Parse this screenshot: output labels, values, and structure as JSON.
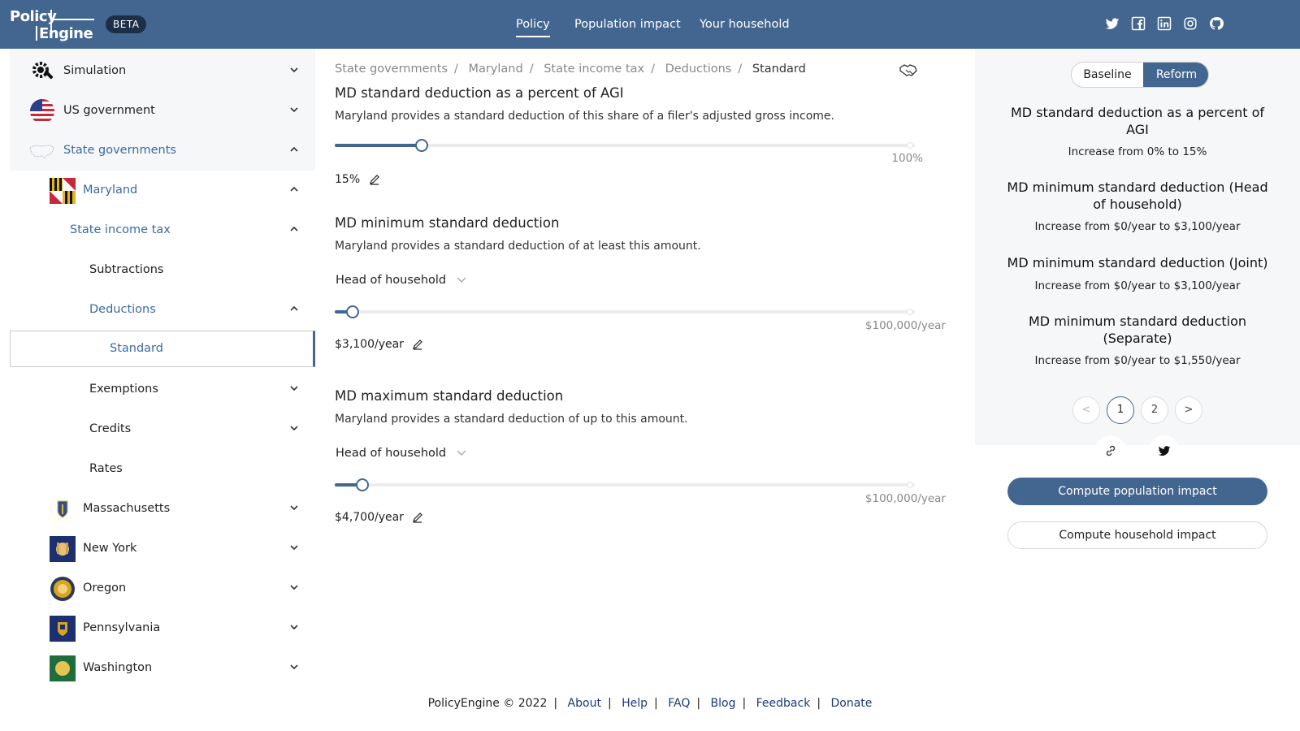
{
  "header": {
    "logo_line1": "Policy",
    "logo_line2": "Engine",
    "beta": "BETA",
    "nav": [
      {
        "label": "Policy",
        "active": true
      },
      {
        "label": "Population impact",
        "active": false
      },
      {
        "label": "Your household",
        "active": false
      }
    ],
    "social_icons": [
      "twitter-icon",
      "facebook-icon",
      "linkedin-icon",
      "instagram-icon",
      "github-icon"
    ],
    "background_color": "#436690"
  },
  "sidebar": {
    "items": [
      {
        "label": "Simulation",
        "icon": "gear-icon",
        "expanded": false
      },
      {
        "label": "US government",
        "icon": "us-flag-icon",
        "expanded": false
      },
      {
        "label": "State governments",
        "icon": "us-map-icon",
        "expanded": true
      },
      {
        "label": "Maryland",
        "icon": "maryland-flag-icon",
        "expanded": true
      },
      {
        "label": "State income tax",
        "expanded": true
      },
      {
        "label": "Subtractions"
      },
      {
        "label": "Deductions",
        "expanded": true
      },
      {
        "label": "Standard",
        "selected": true
      },
      {
        "label": "Exemptions",
        "expanded": false
      },
      {
        "label": "Credits",
        "expanded": false
      },
      {
        "label": "Rates"
      },
      {
        "label": "Massachusetts",
        "icon": "massachusetts-flag-icon",
        "expanded": false
      },
      {
        "label": "New York",
        "icon": "new-york-flag-icon",
        "expanded": false
      },
      {
        "label": "Oregon",
        "icon": "oregon-flag-icon",
        "expanded": false
      },
      {
        "label": "Pennsylvania",
        "icon": "pennsylvania-flag-icon",
        "expanded": false
      },
      {
        "label": "Washington",
        "icon": "washington-flag-icon",
        "expanded": false
      }
    ]
  },
  "main": {
    "breadcrumbs": [
      "State governments",
      "Maryland",
      "State income tax",
      "Deductions",
      "Standard"
    ],
    "parameters": [
      {
        "title": "MD standard deduction as a percent of AGI",
        "description": "Maryland provides a standard deduction of this share of a filer's adjusted gross income.",
        "slider_fraction": 0.15,
        "max_label": "100%",
        "value": "15%"
      },
      {
        "title": "MD minimum standard deduction",
        "description": "Maryland provides a standard deduction of at least this amount.",
        "dropdown": "Head of household",
        "slider_fraction": 0.031,
        "max_label": "$100,000/year",
        "value": "$3,100/year"
      },
      {
        "title": "MD maximum standard deduction",
        "description": "Maryland provides a standard deduction of up to this amount.",
        "dropdown": "Head of household",
        "slider_fraction": 0.047,
        "max_label": "$100,000/year",
        "value": "$4,700/year"
      }
    ]
  },
  "reform_panel": {
    "toggle": {
      "baseline": "Baseline",
      "reform": "Reform"
    },
    "changes": [
      {
        "title": "MD standard deduction as a percent of AGI",
        "desc": "Increase from 0% to 15%"
      },
      {
        "title": "MD minimum standard deduction (Head of household)",
        "desc": "Increase from $0/year to $3,100/year"
      },
      {
        "title": "MD minimum standard deduction (Joint)",
        "desc": "Increase from $0/year to $3,100/year"
      },
      {
        "title": "MD minimum standard deduction (Separate)",
        "desc": "Increase from $0/year to $1,550/year"
      }
    ],
    "pagination": {
      "prev": "<",
      "pages": [
        "1",
        "2"
      ],
      "current": "1",
      "next": ">"
    },
    "compute_population": "Compute population impact",
    "compute_household": "Compute household impact"
  },
  "footer": {
    "copyright": "PolicyEngine © 2022",
    "links": [
      "About",
      "Help",
      "FAQ",
      "Blog",
      "Feedback",
      "Donate"
    ]
  }
}
